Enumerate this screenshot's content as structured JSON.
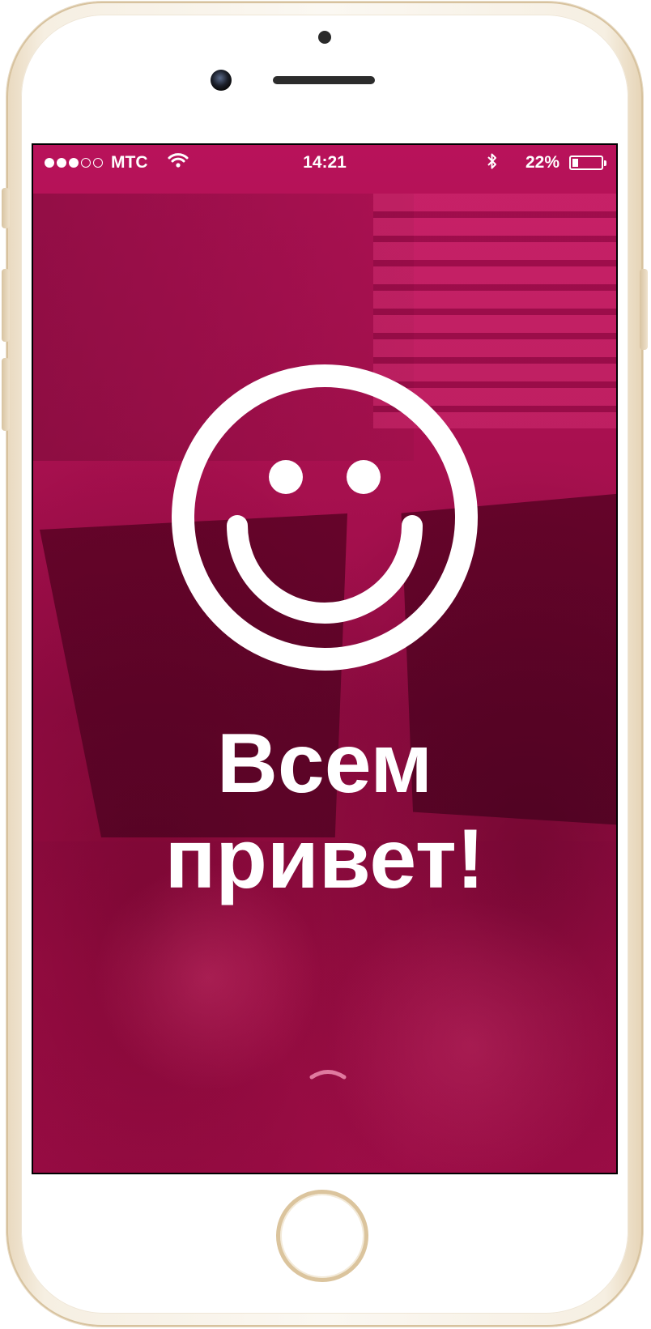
{
  "status_bar": {
    "carrier": "МТС",
    "time": "14:21",
    "battery_percent_label": "22%",
    "battery_level": 0.22,
    "signal_bars_filled": 3,
    "signal_bars_total": 5
  },
  "main": {
    "greeting_line1": "Всем",
    "greeting_line2": "привет!"
  },
  "colors": {
    "overlay": "#b0124f",
    "text": "#ffffff",
    "device_frame": "#e9d9bf"
  },
  "icons": {
    "signal": "signal-dots-icon",
    "wifi": "wifi-icon",
    "bluetooth": "bluetooth-icon",
    "battery": "battery-icon",
    "smiley": "smiley-face-icon",
    "swipe": "chevron-up-icon"
  }
}
